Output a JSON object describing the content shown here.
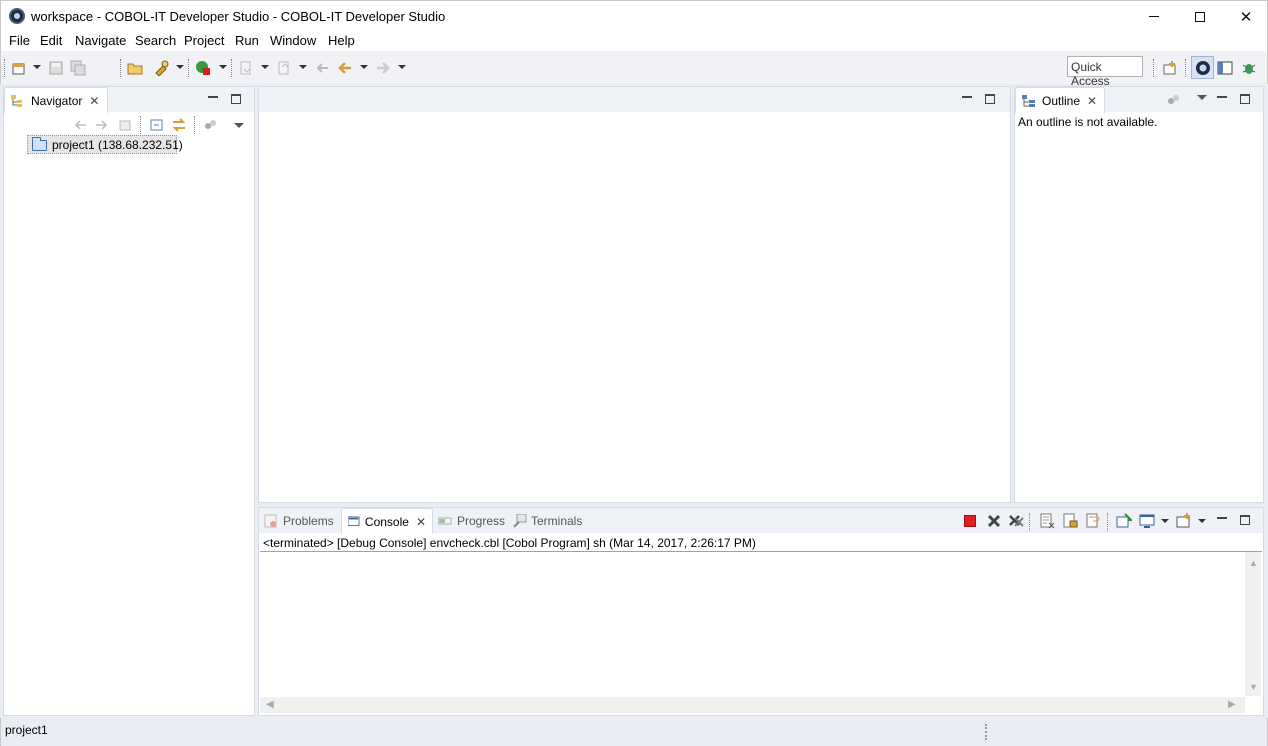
{
  "window": {
    "title": "workspace - COBOL-IT Developer Studio - COBOL-IT Developer Studio"
  },
  "menu": [
    "File",
    "Edit",
    "Navigate",
    "Search",
    "Project",
    "Run",
    "Window",
    "Help"
  ],
  "toolbar": {
    "quick_access_label": "Quick Access"
  },
  "navigator": {
    "tab_label": "Navigator",
    "tree": [
      {
        "label": "project1 (138.68.232.51)",
        "icon": "project-folder-icon"
      }
    ]
  },
  "outline": {
    "tab_label": "Outline",
    "message": "An outline is not available."
  },
  "bottom_panel": {
    "tabs": [
      {
        "label": "Problems",
        "icon": "problems-icon",
        "active": false
      },
      {
        "label": "Console",
        "icon": "console-icon",
        "active": true
      },
      {
        "label": "Progress",
        "icon": "progress-icon",
        "active": false
      },
      {
        "label": "Terminals",
        "icon": "terminals-icon",
        "active": false
      }
    ],
    "console_header": "<terminated> [Debug Console] envcheck.cbl [Cobol Program] sh (Mar 14, 2017, 2:26:17 PM)"
  },
  "status_bar": {
    "text": "project1"
  },
  "colors": {
    "chrome": "#e8ecf3",
    "toolbar": "#f0f2f6",
    "panel_border": "#d6dbe4",
    "stop_red": "#e02020"
  }
}
